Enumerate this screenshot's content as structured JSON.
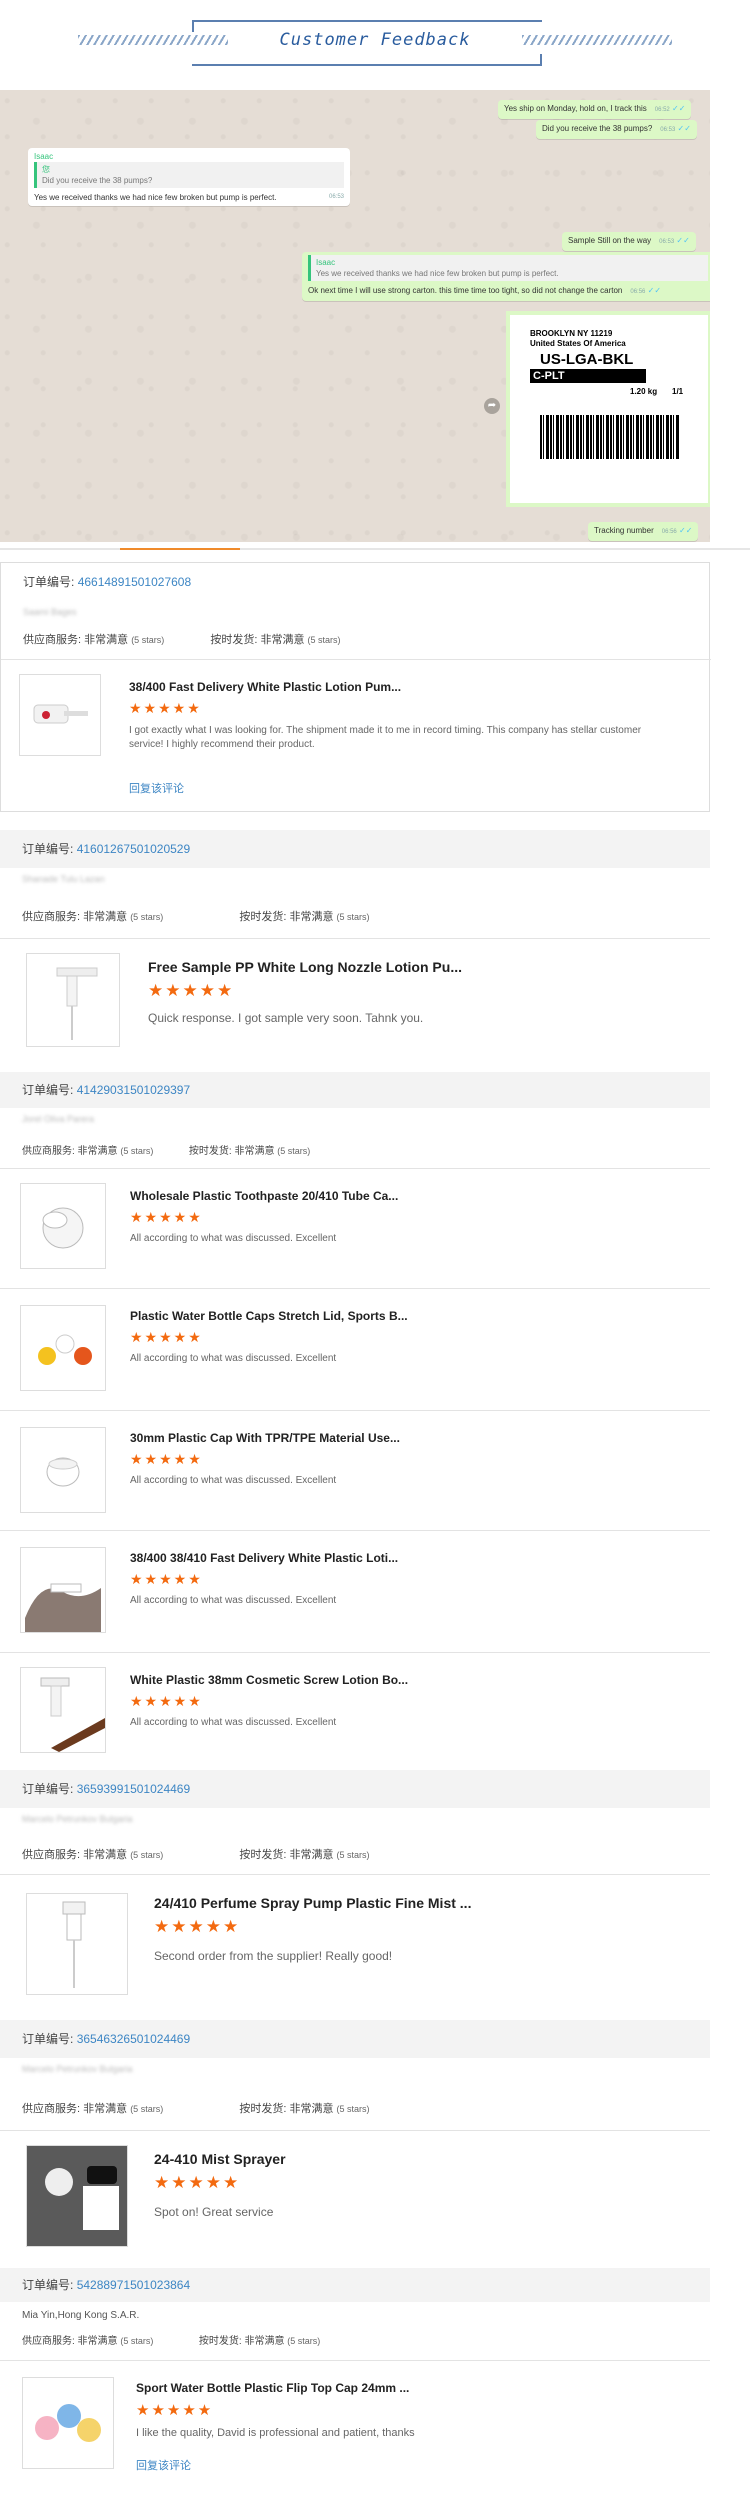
{
  "header": {
    "title": "Customer Feedback"
  },
  "chat": {
    "msg1": "Yes ship on Monday, hold on, I track this",
    "msg1_time": "06:52",
    "msg2": "Did you receive the 38 pumps?",
    "msg2_time": "06:53",
    "in_author": "Isaac",
    "in_quote_author": "您",
    "in_quote": "Did you receive the 38 pumps?",
    "in_text": "Yes we received thanks we had nice few broken but pump is perfect.",
    "in_time": "06:53",
    "msg3": "Sample Still on the way",
    "msg3_time": "06:53",
    "out_quote_author": "Isaac",
    "out_quote": "Yes we received thanks we had nice few broken but pump is perfect.",
    "msg4": "Ok next time I will use strong carton. this time time too tight, so did not change the carton",
    "msg4_time": "06:56",
    "label_city": "BROOKLYN NY 11219",
    "label_country": "United States Of America",
    "label_code": "US-LGA-BKL",
    "label_plt": "C-PLT",
    "label_weight": "1.20 kg",
    "label_count": "1/1",
    "msg5": "Tracking number",
    "msg5_time": "06:56"
  },
  "common": {
    "order_label": "订单编号:",
    "supplier_service": "供应商服务: 非常满意",
    "on_time": "按时发货: 非常满意",
    "five_stars": "(5 stars)",
    "stars": "★★★★★",
    "reply": "回复该评论"
  },
  "orders": [
    {
      "number": "46614891501027608",
      "buyer": "Saami Bages",
      "items": [
        {
          "name": "38/400 Fast Delivery White Plastic Lotion Pum...",
          "review": "I got exactly what I was looking for.  The shipment made it to me in record timing.  This company has stellar customer service!  I highly recommend their product."
        }
      ]
    },
    {
      "number": "41601267501020529",
      "buyer": "Shanade Tulu Lazan",
      "items": [
        {
          "name": "Free Sample PP White Long Nozzle Lotion Pu...",
          "review": "Quick response. I got sample very soon. Tahnk you."
        }
      ]
    },
    {
      "number": "41429031501029397",
      "buyer": "Jorel Oliva Parera",
      "items": [
        {
          "name": "Wholesale Plastic Toothpaste 20/410 Tube Ca...",
          "review": "All according to what was discussed. Excellent"
        },
        {
          "name": "Plastic Water Bottle Caps Stretch Lid, Sports B...",
          "review": "All according to what was discussed. Excellent"
        },
        {
          "name": "30mm Plastic Cap With TPR/TPE Material Use...",
          "review": "All according to what was discussed. Excellent"
        },
        {
          "name": "38/400 38/410 Fast Delivery White Plastic Loti...",
          "review": "All according to what was discussed. Excellent"
        },
        {
          "name": "White Plastic 38mm Cosmetic Screw Lotion Bo...",
          "review": "All according to what was discussed. Excellent"
        }
      ]
    },
    {
      "number": "36593991501024469",
      "buyer": "Marcelo Petrunkov Bulgaria",
      "items": [
        {
          "name": "24/410 Perfume Spray Pump Plastic Fine Mist ...",
          "review": "Second order from the supplier! Really good!"
        }
      ]
    },
    {
      "number": "36546326501024469",
      "buyer": "Marcelo Petrunkov Bulgaria",
      "items": [
        {
          "name": "24-410 Mist Sprayer",
          "review": "Spot on! Great service"
        }
      ]
    },
    {
      "number": "54288971501023864",
      "buyer": "Mia Yin,Hong Kong S.A.R.",
      "items": [
        {
          "name": "Sport Water Bottle Plastic Flip Top Cap 24mm ...",
          "review": "I like the quality, David is professional and patient, thanks"
        }
      ]
    }
  ]
}
